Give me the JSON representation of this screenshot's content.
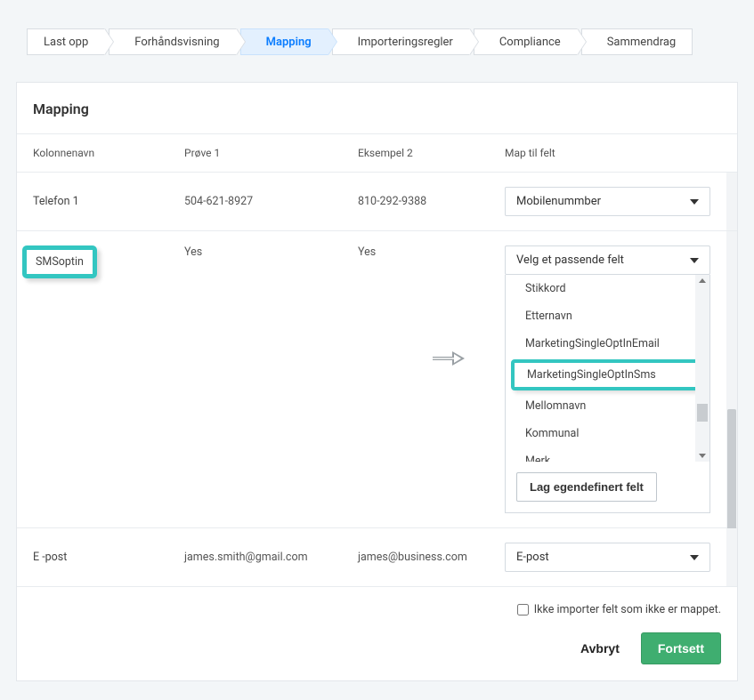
{
  "steps": [
    {
      "label": "Last opp",
      "active": false
    },
    {
      "label": "Forhåndsvisning",
      "active": false
    },
    {
      "label": "Mapping",
      "active": true
    },
    {
      "label": "Importeringsregler",
      "active": false
    },
    {
      "label": "Compliance",
      "active": false
    },
    {
      "label": "Sammendrag",
      "active": false
    }
  ],
  "panel": {
    "title": "Mapping",
    "columns": {
      "name": "Kolonnenavn",
      "sample1": "Prøve 1",
      "sample2": "Eksempel 2",
      "mapto": "Map til felt"
    },
    "rows": [
      {
        "name": "Telefon 1",
        "sample1": "504-621-8927",
        "sample2": "810-292-9388",
        "selected": "Mobilenummber"
      },
      {
        "name": "SMSoptin",
        "sample1": "Yes",
        "sample2": "Yes",
        "selected": "Velg et passende felt",
        "dropdown_open": true,
        "options": [
          "Stikkord",
          "Etternavn",
          "MarketingSingleOptInEmail",
          "MarketingSingleOptInSms",
          "Mellomnavn",
          "Kommunal",
          "Merk"
        ],
        "highlight_index": 3,
        "custom_button": "Lag egendefinert felt"
      },
      {
        "name": "E -post",
        "sample1": "james.smith@gmail.com",
        "sample2": "james@business.com",
        "selected": "E-post"
      }
    ]
  },
  "footer": {
    "checkbox_label": "Ikke importer felt som ikke er mappet.",
    "cancel": "Avbryt",
    "continue": "Fortsett"
  }
}
